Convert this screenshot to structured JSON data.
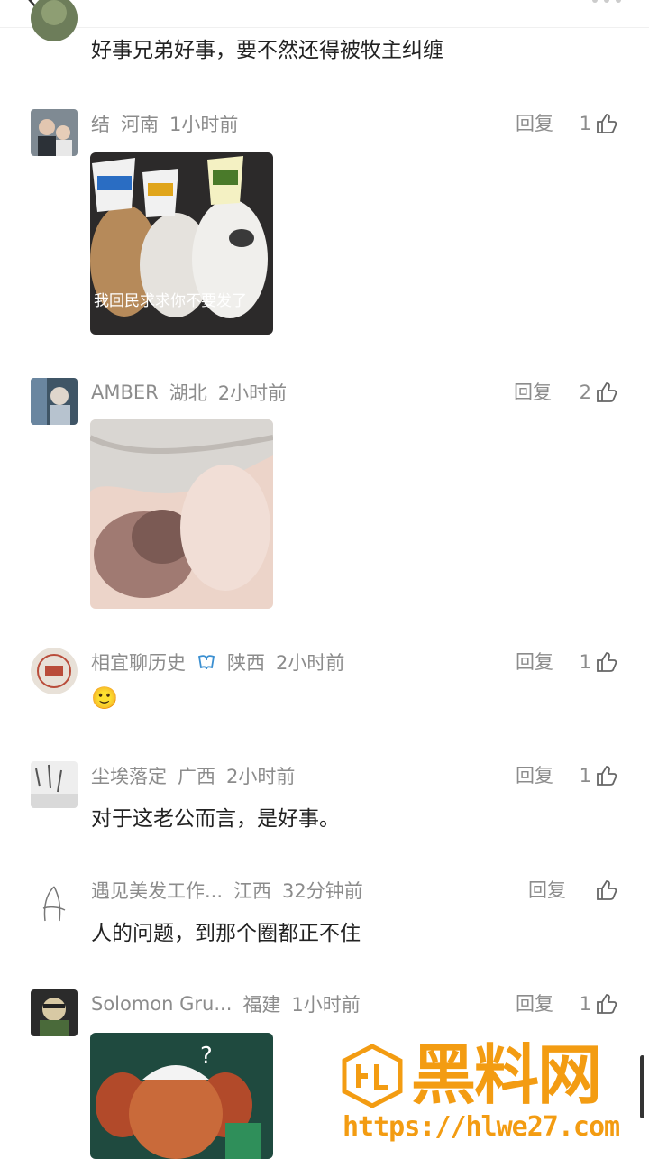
{
  "header": {
    "back_icon": "chevron-left-icon"
  },
  "comments": [
    {
      "user": "",
      "region": "",
      "time": "",
      "text": "好事兄弟好事，要不然还得被牧主纠缠"
    },
    {
      "user": "结",
      "region": "河南",
      "time": "1小时前",
      "reply": "回复",
      "likes": "1",
      "image_caption": "我回民求求你不要发了"
    },
    {
      "user": "AMBER",
      "region": "湖北",
      "time": "2小时前",
      "reply": "回复",
      "likes": "2"
    },
    {
      "user": "相宜聊历史",
      "region": "陕西",
      "time": "2小时前",
      "reply": "回复",
      "likes": "1",
      "text": "🙂"
    },
    {
      "user": "尘埃落定",
      "region": "广西",
      "time": "2小时前",
      "reply": "回复",
      "likes": "1",
      "text": "对于这老公而言，是好事。"
    },
    {
      "user": "遇见美发工作...",
      "region": "江西",
      "time": "32分钟前",
      "reply": "回复",
      "likes": "",
      "text": "人的问题，到那个圈都正不住"
    },
    {
      "user": "Solomon Gru...",
      "region": "福建",
      "time": "1小时前",
      "reply": "回复",
      "likes": "1"
    }
  ],
  "watermark": {
    "title": "黑料网",
    "url": "https://hlwe27.com"
  },
  "colors": {
    "meta_gray": "#8c8c8c",
    "watermark_orange": "#f39c12"
  }
}
